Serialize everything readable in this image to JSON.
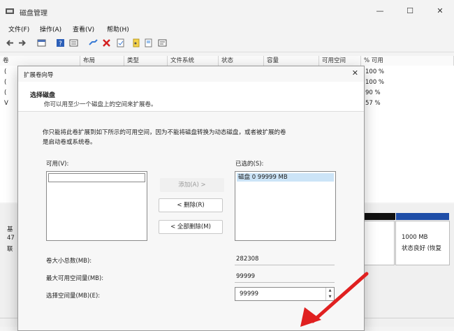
{
  "window": {
    "title": "磁盘管理",
    "minimize": "—",
    "maximize": "☐",
    "close": "✕"
  },
  "menu": [
    "文件(F)",
    "操作(A)",
    "查看(V)",
    "帮助(H)"
  ],
  "toolbar_icons": [
    "back-icon",
    "forward-icon",
    "volume-list-icon",
    "help-icon",
    "disk-list-icon",
    "connect-icon",
    "delete-icon",
    "properties-icon",
    "open-icon",
    "explore-icon",
    "rescan-icon"
  ],
  "volume_list": {
    "columns": [
      "卷",
      "布局",
      "类型",
      "文件系统",
      "状态",
      "容量",
      "可用空间",
      "% 可用"
    ],
    "rows": [
      {
        "name": "(",
        "free_pct": "100 %"
      },
      {
        "name": "(",
        "free_pct": "100 %"
      },
      {
        "name": "(",
        "free_pct": "90 %"
      },
      {
        "name": "V",
        "free_pct": "57 %"
      }
    ]
  },
  "disk_area": {
    "labels": [
      "基",
      "47",
      "联"
    ],
    "partition": {
      "size": "1000 MB",
      "status": "状态良好 (恢复"
    }
  },
  "dialog": {
    "title": "扩展卷向导",
    "close": "✕",
    "header_title": "选择磁盘",
    "header_subtitle": "你可以用至少一个磁盘上的空间来扩展卷。",
    "description_line1": "你只能将此卷扩展到如下所示的可用空间，因为不能将磁盘转换为动态磁盘，或者被扩展的卷",
    "description_line2": "是启动卷或系统卷。",
    "available_label": "可用(V):",
    "selected_label": "已选的(S):",
    "selected_items": [
      "磁盘 0     99999 MB"
    ],
    "add_button": "添加(A) >",
    "remove_button": "< 删除(R)",
    "remove_all_button": "< 全部删除(M)",
    "total_size_label": "卷大小总数(MB):",
    "total_size_value": "282308",
    "max_space_label": "最大可用空间量(MB):",
    "max_space_value": "99999",
    "select_space_label": "选择空间量(MB)(E):",
    "select_space_value": "99999",
    "spin_up": "▲",
    "spin_down": "▼"
  },
  "colors": {
    "primary_partition": "#1f4ea8",
    "unallocated": "#101010",
    "selection": "#cce4f7",
    "annotation_arrow": "#e02020"
  }
}
